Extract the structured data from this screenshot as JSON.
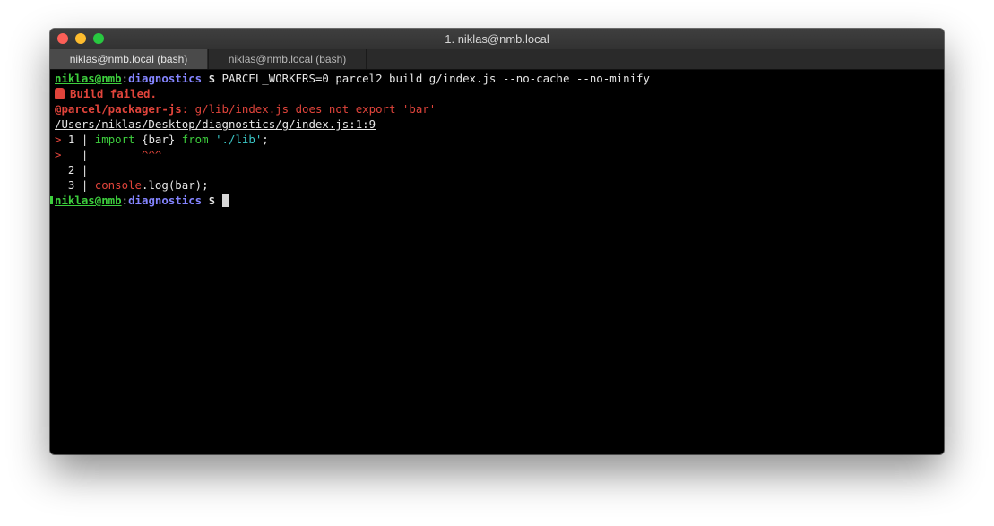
{
  "window": {
    "title": "1. niklas@nmb.local",
    "traffic_lights": {
      "close_color": "#fc5f57",
      "minimize_color": "#fdbc2e",
      "zoom_color": "#28c840"
    }
  },
  "tabs": [
    {
      "label": "niklas@nmb.local (bash)",
      "active": true
    },
    {
      "label": "niklas@nmb.local (bash)",
      "active": false
    }
  ],
  "terminal": {
    "prompt": {
      "user_host": "niklas@nmb",
      "separator": ":",
      "cwd": "diagnostics",
      "symbol": " $ "
    },
    "command": "PARCEL_WORKERS=0 parcel2 build g/index.js --no-cache --no-minify",
    "build_failed": "Build failed.",
    "error_origin": "@parcel/packager-js",
    "error_message": ": g/lib/index.js does not export 'bar'",
    "file_location": "/Users/niklas/Desktop/diagnostics/g/index.js:1:9",
    "code_frame": {
      "line1": {
        "marker": ">",
        "number": " 1 | ",
        "kw_import": "import",
        "braces": " {bar} ",
        "kw_from": "from",
        "string": " './lib'",
        "end": ";"
      },
      "line_caret": {
        "marker": ">",
        "gutter": "   | ",
        "carets": "       ^^^"
      },
      "line2": {
        "number": "  2 |"
      },
      "line3": {
        "number": "  3 | ",
        "console": "console",
        "rest": ".log(bar);"
      }
    },
    "icon": "siren-icon"
  }
}
